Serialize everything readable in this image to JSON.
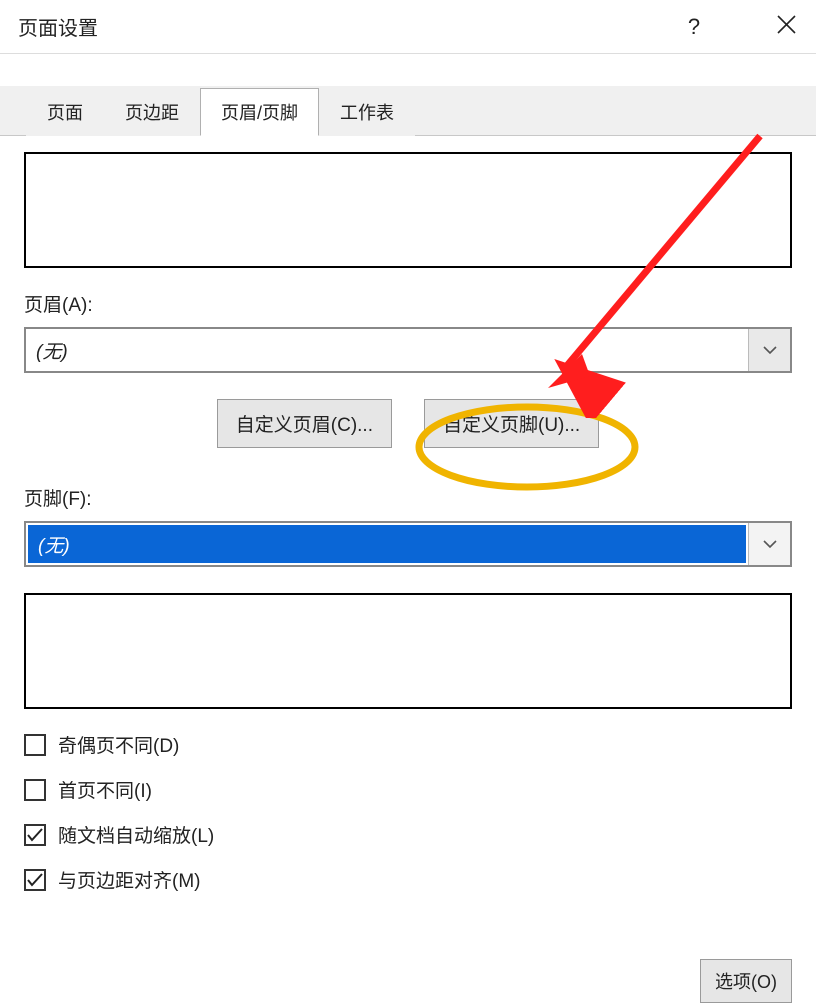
{
  "titlebar": {
    "title": "页面设置",
    "help": "?",
    "close": "×"
  },
  "tabs": {
    "page": "页面",
    "margins": "页边距",
    "header_footer": "页眉/页脚",
    "worksheet": "工作表",
    "selected": "header_footer"
  },
  "header": {
    "label": "页眉(A):",
    "value": "(无)"
  },
  "buttons": {
    "custom_header": "自定义页眉(C)...",
    "custom_footer": "自定义页脚(U)..."
  },
  "footer": {
    "label": "页脚(F):",
    "value": "(无)"
  },
  "checkboxes": {
    "odd_even": {
      "label": "奇偶页不同(D)",
      "checked": false
    },
    "first_page": {
      "label": "首页不同(I)",
      "checked": false
    },
    "scale": {
      "label": "随文档自动缩放(L)",
      "checked": true
    },
    "align_margins": {
      "label": "与页边距对齐(M)",
      "checked": true
    }
  },
  "options_btn": "选项(O)"
}
